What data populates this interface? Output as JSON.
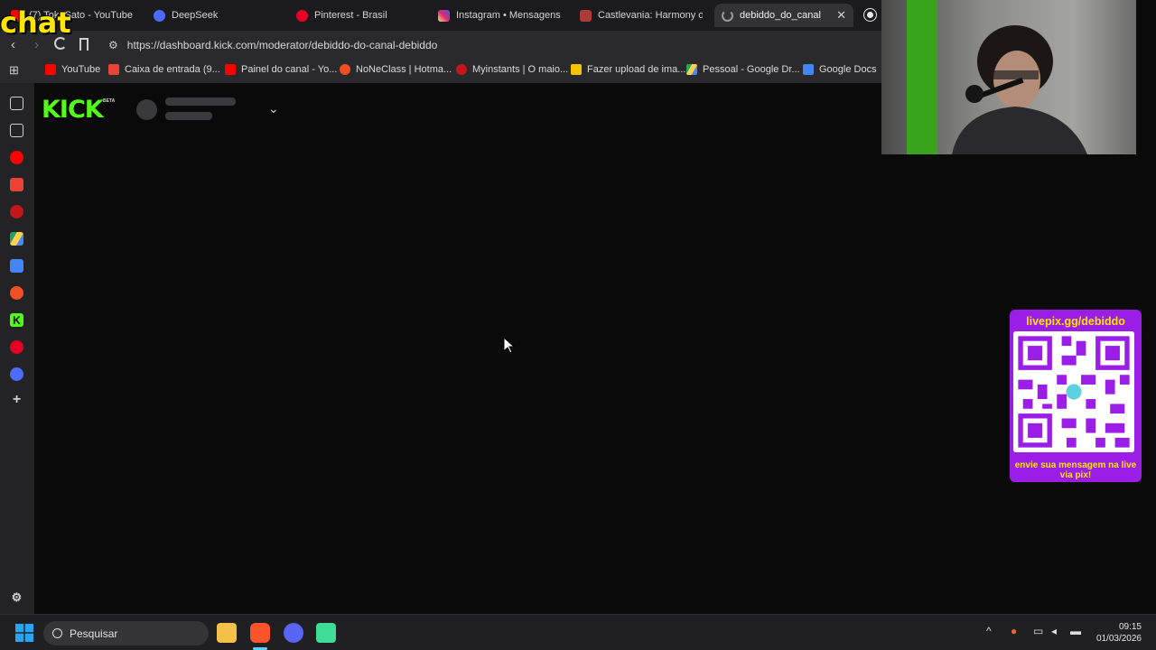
{
  "browser": {
    "tabs": [
      {
        "label": "(7) TokuSato - YouTube",
        "icon": "youtube-icon",
        "color": "#ff0000"
      },
      {
        "label": "DeepSeek",
        "icon": "deepseek-icon",
        "color": "#4d6bfe"
      },
      {
        "label": "Pinterest - Brasil",
        "icon": "pinterest-icon",
        "color": "#e60023"
      },
      {
        "label": "Instagram • Mensagens",
        "icon": "instagram-icon",
        "color": "#d62976"
      },
      {
        "label": "Castlevania: Harmony of D",
        "icon": "castlevania-icon",
        "color": "#b03a3a"
      },
      {
        "label": "debiddo_do_canal_de",
        "icon": "loading-icon",
        "color": "#9a9a9a",
        "active": true
      }
    ],
    "url": "https://dashboard.kick.com/moderator/debiddo-do-canal-debiddo",
    "bookmarks": [
      {
        "label": "YouTube",
        "icon": "youtube-icon",
        "color": "#ff0000"
      },
      {
        "label": "Caixa de entrada (9...",
        "icon": "gmail-icon",
        "color": "#ea4335"
      },
      {
        "label": "Painel do canal - Yo...",
        "icon": "youtube-studio-icon",
        "color": "#ff0000"
      },
      {
        "label": "NoNeClass | Hotma...",
        "icon": "hotmart-icon",
        "color": "#f04e23"
      },
      {
        "label": "Myinstants | O maio...",
        "icon": "myinstants-icon",
        "color": "#c4161c"
      },
      {
        "label": "Fazer upload de ima...",
        "icon": "upload-icon",
        "color": "#f5c400"
      },
      {
        "label": "Pessoal - Google Dr...",
        "icon": "google-drive-icon",
        "color": "#1fa463"
      },
      {
        "label": "Google Docs",
        "icon": "google-docs-icon",
        "color": "#4285f4"
      }
    ]
  },
  "siderail": [
    {
      "name": "reading-list-icon",
      "color": "#d0d0d0"
    },
    {
      "name": "notes-icon",
      "color": "#d0d0d0"
    },
    {
      "name": "youtube-icon",
      "color": "#ff0000"
    },
    {
      "name": "gmail-icon",
      "color": "#ea4335"
    },
    {
      "name": "myinstants-icon",
      "color": "#c4161c"
    },
    {
      "name": "google-drive-icon",
      "color": "#1fa463"
    },
    {
      "name": "google-docs-icon",
      "color": "#4285f4"
    },
    {
      "name": "hotmart-icon",
      "color": "#f04e23"
    },
    {
      "name": "kick-icon",
      "color": "#53fc18"
    },
    {
      "name": "pinterest-icon",
      "color": "#e60023"
    },
    {
      "name": "deepseek-icon",
      "color": "#4d6bfe"
    },
    {
      "name": "add-icon",
      "color": "#d0d0d0"
    }
  ],
  "page": {
    "logo": "KICK",
    "logo_badge": "BETA",
    "brand_color": "#53fc18"
  },
  "overlay": {
    "chat_label": "chat",
    "livepix_title": "livepix.gg/debiddo",
    "livepix_footer": "envie sua mensagem na live via pix!",
    "livepix_color": "#9b1ee6"
  },
  "taskbar": {
    "search_placeholder": "Pesquisar",
    "time": "09:15",
    "date": "01/03/2026"
  }
}
